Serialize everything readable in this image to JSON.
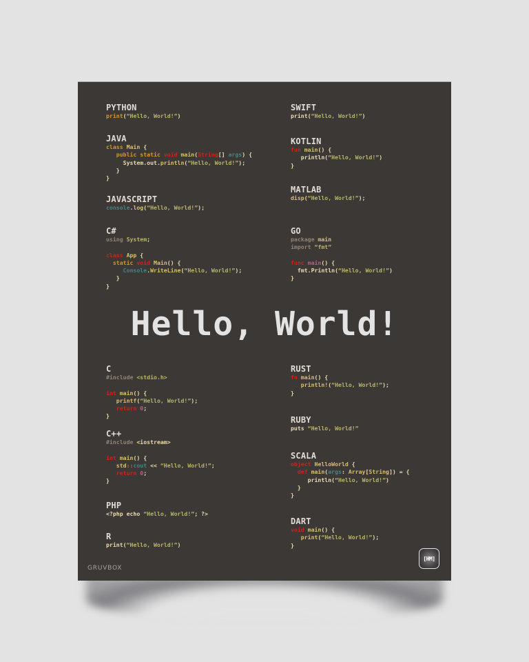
{
  "poster": {
    "title": "Hello, World!",
    "brand": "GRUVBOX",
    "logo_text": "[HM]"
  },
  "colors": {
    "background": "#3c3836",
    "page_background": "#e3e3e3",
    "foreground": "#ebdbb2",
    "red": "#cc241d",
    "yellow": "#d79921",
    "aqua": "#458588",
    "green": "#b8bb26",
    "gray": "#928374",
    "purple": "#b16286"
  },
  "languages": [
    {
      "name": "PYTHON",
      "lines": [
        [
          [
            "print",
            "yel"
          ],
          [
            "(",
            "fg"
          ],
          [
            "“Hello, World!”",
            "strg"
          ],
          [
            ")",
            "fg"
          ]
        ]
      ]
    },
    {
      "name": "JAVA",
      "lines": [
        [
          [
            "class ",
            "yel"
          ],
          [
            "Main",
            "ylt"
          ],
          [
            " {",
            "fg"
          ]
        ],
        [
          [
            "   public static ",
            "yel"
          ],
          [
            "void ",
            "red"
          ],
          [
            "main",
            "ylt"
          ],
          [
            "(",
            "fg"
          ],
          [
            "String",
            "red"
          ],
          [
            "[] ",
            "fg"
          ],
          [
            "args",
            "aqua"
          ],
          [
            ") {",
            "fg"
          ]
        ],
        [
          [
            "     System.out.",
            "fg"
          ],
          [
            "println",
            "ylt"
          ],
          [
            "(",
            "fg"
          ],
          [
            "“Hello, World!”",
            "strg"
          ],
          [
            ");",
            "fg"
          ]
        ],
        [
          [
            "   }",
            "fg"
          ]
        ],
        [
          [
            "}",
            "fg"
          ]
        ]
      ]
    },
    {
      "name": "JAVASCRIPT",
      "lines": [
        [
          [
            "console",
            "aqua"
          ],
          [
            ".",
            "fg"
          ],
          [
            "log",
            "ylt"
          ],
          [
            "(",
            "fg"
          ],
          [
            "“Hello, World!”",
            "strg"
          ],
          [
            ");",
            "fg"
          ]
        ]
      ]
    },
    {
      "name": "C#",
      "lines": [
        [
          [
            "using ",
            "gray"
          ],
          [
            "System",
            "strg"
          ],
          [
            ";",
            "fg"
          ]
        ],
        [
          [
            "",
            "fg"
          ]
        ],
        [
          [
            "class ",
            "red"
          ],
          [
            "App",
            "ylt"
          ],
          [
            " {",
            "fg"
          ]
        ],
        [
          [
            "  static ",
            "yel"
          ],
          [
            "void ",
            "red"
          ],
          [
            "Main",
            "ylt"
          ],
          [
            "() {",
            "fg"
          ]
        ],
        [
          [
            "     Console",
            "aqua"
          ],
          [
            ".",
            "fg"
          ],
          [
            "WriteLine",
            "ylt"
          ],
          [
            "(",
            "fg"
          ],
          [
            "“Hello, World!”",
            "strg"
          ],
          [
            ");",
            "fg"
          ]
        ],
        [
          [
            "   }",
            "fg"
          ]
        ],
        [
          [
            "}",
            "fg"
          ]
        ]
      ]
    },
    {
      "name": "SWIFT",
      "lines": [
        [
          [
            "print",
            "fg"
          ],
          [
            "(",
            "fg"
          ],
          [
            "“Hello, World!”",
            "strg"
          ],
          [
            ")",
            "fg"
          ]
        ]
      ]
    },
    {
      "name": "KOTLIN",
      "lines": [
        [
          [
            "fun ",
            "red"
          ],
          [
            "main",
            "ylt"
          ],
          [
            "() {",
            "fg"
          ]
        ],
        [
          [
            "   println",
            "fg"
          ],
          [
            "(",
            "fg"
          ],
          [
            "“Hello, World!”",
            "strg"
          ],
          [
            ")",
            "fg"
          ]
        ],
        [
          [
            "}",
            "fg"
          ]
        ]
      ]
    },
    {
      "name": "MATLAB",
      "lines": [
        [
          [
            "disp",
            "ylt"
          ],
          [
            "(",
            "fg"
          ],
          [
            "“Hello, World!”",
            "strg"
          ],
          [
            ");",
            "fg"
          ]
        ]
      ]
    },
    {
      "name": "GO",
      "lines": [
        [
          [
            "package ",
            "gray"
          ],
          [
            "main",
            "ylt"
          ]
        ],
        [
          [
            "import ",
            "gray"
          ],
          [
            "“fmt”",
            "strg"
          ]
        ],
        [
          [
            "",
            "fg"
          ]
        ],
        [
          [
            "func ",
            "red"
          ],
          [
            "main",
            "pur"
          ],
          [
            "() {",
            "fg"
          ]
        ],
        [
          [
            "  fmt.Println",
            "fg"
          ],
          [
            "(",
            "fg"
          ],
          [
            "“Hello, World!”",
            "strg"
          ],
          [
            ")",
            "fg"
          ]
        ],
        [
          [
            "}",
            "fg"
          ]
        ]
      ]
    },
    {
      "name": "C",
      "lines": [
        [
          [
            "#include ",
            "gray"
          ],
          [
            "<stdio.h>",
            "strg"
          ]
        ],
        [
          [
            "",
            "fg"
          ]
        ],
        [
          [
            "int ",
            "red"
          ],
          [
            "main",
            "ylt"
          ],
          [
            "() {",
            "fg"
          ]
        ],
        [
          [
            "   printf",
            "ylt"
          ],
          [
            "(",
            "fg"
          ],
          [
            "“Hello, World!”",
            "strg"
          ],
          [
            ");",
            "fg"
          ]
        ],
        [
          [
            "   return ",
            "red"
          ],
          [
            "0",
            "pur"
          ],
          [
            ";",
            "fg"
          ]
        ],
        [
          [
            "}",
            "fg"
          ]
        ]
      ]
    },
    {
      "name": "C++",
      "lines": [
        [
          [
            "#include ",
            "gray"
          ],
          [
            "<iostream>",
            "fg"
          ]
        ],
        [
          [
            "",
            "fg"
          ]
        ],
        [
          [
            "int ",
            "red"
          ],
          [
            "main",
            "ylt"
          ],
          [
            "() {",
            "fg"
          ]
        ],
        [
          [
            "   std",
            "ylt"
          ],
          [
            "::",
            "gray"
          ],
          [
            "cout",
            "aqua"
          ],
          [
            " << ",
            "fg"
          ],
          [
            "“Hello, World!”",
            "strg"
          ],
          [
            ";",
            "fg"
          ]
        ],
        [
          [
            "   return ",
            "red"
          ],
          [
            "0",
            "pur"
          ],
          [
            ";",
            "fg"
          ]
        ],
        [
          [
            "}",
            "fg"
          ]
        ]
      ]
    },
    {
      "name": "PHP",
      "lines": [
        [
          [
            "<?php echo ",
            "fg"
          ],
          [
            "“Hello, World!”",
            "strg"
          ],
          [
            "; ?>",
            "fg"
          ]
        ]
      ]
    },
    {
      "name": "R",
      "lines": [
        [
          [
            "print",
            "fg"
          ],
          [
            "(",
            "fg"
          ],
          [
            "“Hello, World!”",
            "strg"
          ],
          [
            ")",
            "fg"
          ]
        ]
      ]
    },
    {
      "name": "RUST",
      "lines": [
        [
          [
            "fn ",
            "red"
          ],
          [
            "main",
            "ylt"
          ],
          [
            "() {",
            "fg"
          ]
        ],
        [
          [
            "   println!",
            "ylt"
          ],
          [
            "(",
            "fg"
          ],
          [
            "“Hello, World!”",
            "strg"
          ],
          [
            ");",
            "fg"
          ]
        ],
        [
          [
            "}",
            "fg"
          ]
        ]
      ]
    },
    {
      "name": "RUBY",
      "lines": [
        [
          [
            "puts ",
            "fg"
          ],
          [
            "“Hello, World!”",
            "strg"
          ]
        ]
      ]
    },
    {
      "name": "SCALA",
      "lines": [
        [
          [
            "object ",
            "red"
          ],
          [
            "HelloWorld",
            "ylt"
          ],
          [
            " {",
            "fg"
          ]
        ],
        [
          [
            "  def ",
            "red"
          ],
          [
            "main",
            "ylt"
          ],
          [
            "(",
            "fg"
          ],
          [
            "args",
            "aqua"
          ],
          [
            ": ",
            "fg"
          ],
          [
            "Array",
            "ylt"
          ],
          [
            "[",
            "fg"
          ],
          [
            "String",
            "ylt"
          ],
          [
            "]) = {",
            "fg"
          ]
        ],
        [
          [
            "     println",
            "fg"
          ],
          [
            "(",
            "fg"
          ],
          [
            "“Hello, World!”",
            "strg"
          ],
          [
            ")",
            "fg"
          ]
        ],
        [
          [
            "  }",
            "fg"
          ]
        ],
        [
          [
            "}",
            "fg"
          ]
        ]
      ]
    },
    {
      "name": "DART",
      "lines": [
        [
          [
            "void ",
            "red"
          ],
          [
            "main",
            "ylt"
          ],
          [
            "() {",
            "fg"
          ]
        ],
        [
          [
            "   print",
            "ylt"
          ],
          [
            "(",
            "fg"
          ],
          [
            "“Hello, World!”",
            "strg"
          ],
          [
            ");",
            "fg"
          ]
        ],
        [
          [
            "}",
            "fg"
          ]
        ]
      ]
    }
  ]
}
